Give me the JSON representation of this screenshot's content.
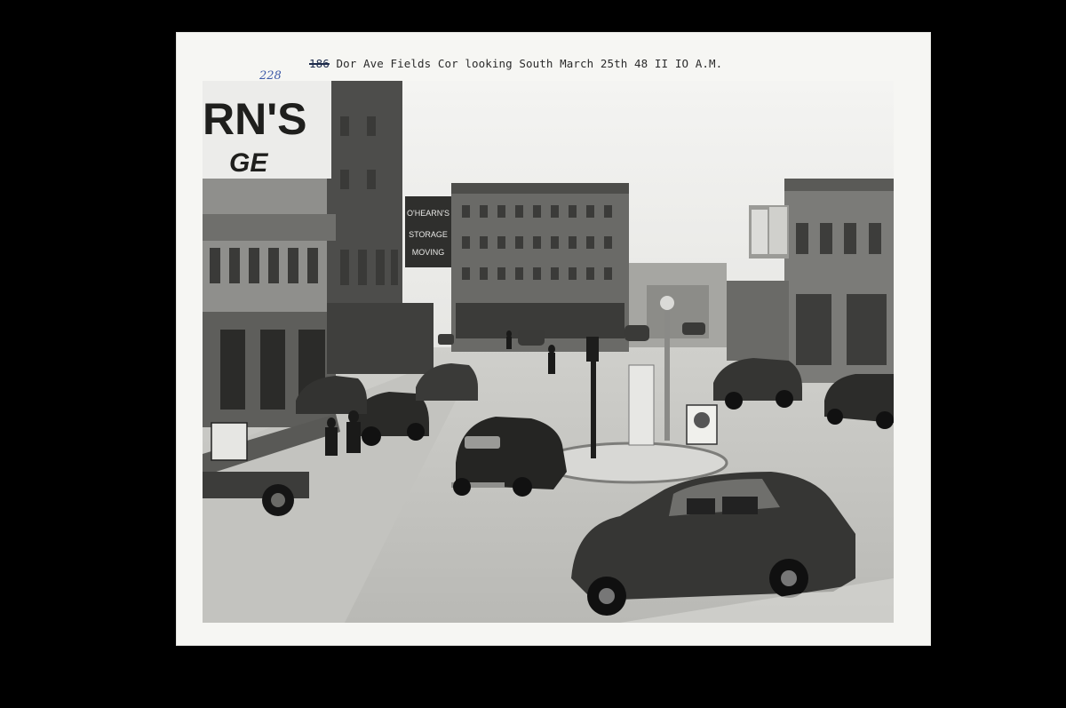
{
  "caption": {
    "struck_number": "186",
    "text": "Dor Ave Fields Cor looking South March 25th 48 II IO A.M.",
    "handwritten_number": "228"
  },
  "photo_signage": {
    "billboard_top": "RN'S",
    "billboard_bottom": "GE",
    "roof_sign_line1": "O'HEARN'S",
    "roof_sign_line2": "STORAGE",
    "roof_sign_line3": "MOVING"
  },
  "colors": {
    "background": "#000000",
    "paper": "#f6f6f3",
    "ink_blue": "#3d5aa8"
  }
}
